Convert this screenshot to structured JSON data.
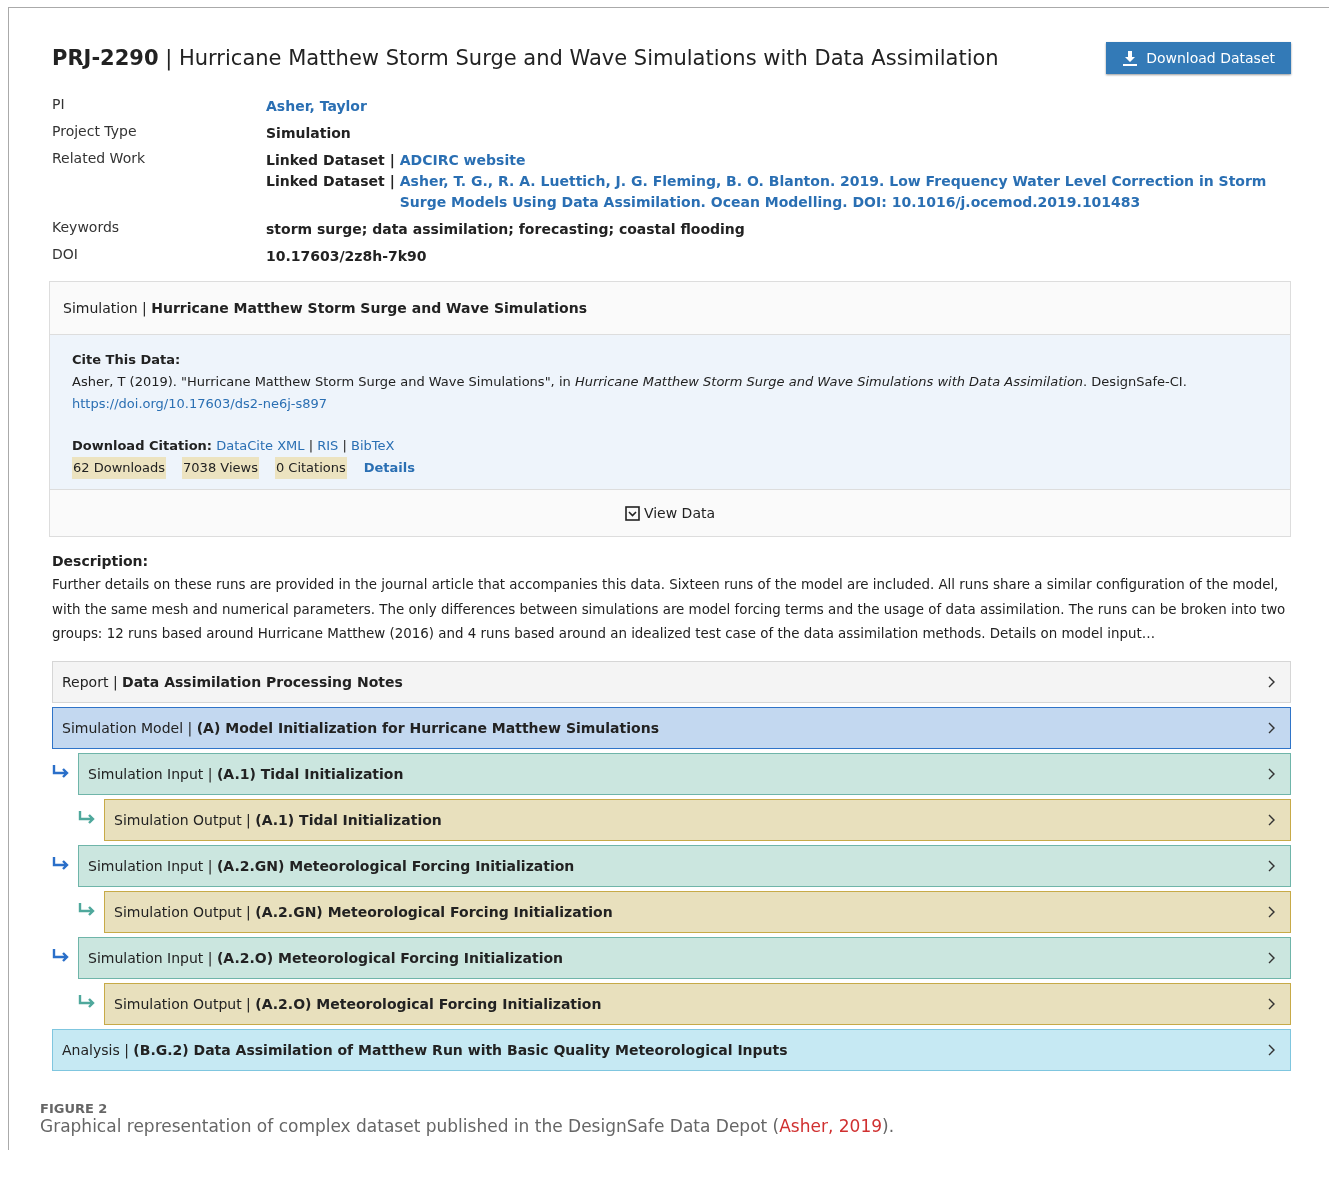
{
  "header": {
    "project_id": "PRJ-2290",
    "separator": "|",
    "title": "Hurricane Matthew Storm Surge and Wave Simulations with Data Assimilation",
    "download_button": "Download Dataset"
  },
  "metadata": [
    {
      "kind": "link",
      "label": "PI",
      "value": "Asher, Taylor"
    },
    {
      "kind": "text",
      "label": "Project Type",
      "value": "Simulation"
    },
    {
      "kind": "related",
      "label": "Related Work",
      "items": [
        {
          "type": "Linked Dataset",
          "separator": "|",
          "link": "ADCIRC website"
        },
        {
          "type": "Linked Dataset",
          "separator": "|",
          "link": "Asher, T. G., R. A. Luettich, J. G. Fleming, B. O. Blanton. 2019. Low Frequency Water Level Correction in Storm Surge Models Using Data Assimilation. Ocean Modelling. DOI: 10.1016/j.ocemod.2019.101483"
        }
      ]
    },
    {
      "kind": "text",
      "label": "Keywords",
      "value": "storm surge; data assimilation; forecasting; coastal flooding"
    },
    {
      "kind": "text",
      "label": "DOI",
      "value": "10.17603/2z8h-7k90"
    }
  ],
  "simulation_panel": {
    "type": "Simulation",
    "separator": "|",
    "title": "Hurricane Matthew Storm Surge and Wave Simulations",
    "cite_heading": "Cite This Data:",
    "citation": "Asher, T (2019). \"Hurricane Matthew Storm Surge and Wave Simulations\", in *Hurricane Matthew Storm Surge and Wave Simulations with Data Assimilation*. DesignSafe-CI.",
    "doi_link": "https://doi.org/10.17603/ds2-ne6j-s897",
    "download_citation_label": "Download Citation:",
    "citation_formats": [
      {
        "name": "DataCite XML"
      },
      {
        "separator": "|",
        "name": "RIS"
      },
      {
        "separator": "|",
        "name": "BibTeX"
      }
    ],
    "stats": [
      "62 Downloads",
      "7038 Views",
      "0 Citations"
    ],
    "details_link": "Details",
    "view_data_button": "View Data"
  },
  "description": {
    "heading": "Description:",
    "text": "Further details on these runs are provided in the journal article that accompanies this data. Sixteen runs of the model are included. All runs share a similar configuration of the model, with the same mesh and numerical parameters. The only differences between simulations are model forcing terms and the usage of data assimilation. The runs can be broken into two groups: 12 runs based around Hurricane Matthew (2016) and 4 runs based around an idealized test case of the data assimilation methods. Details on model input…"
  },
  "entries": [
    {
      "kind": "report",
      "type": "Report",
      "separator": "|",
      "title": "Data Assimilation Processing Notes"
    },
    {
      "kind": "model",
      "type": "Simulation Model",
      "separator": "|",
      "title": "(A) Model Initialization for Hurricane Matthew Simulations",
      "children": [
        {
          "kind": "input",
          "type": "Simulation Input",
          "separator": "|",
          "title": "(A.1) Tidal Initialization",
          "children": [
            {
              "kind": "output",
              "type": "Simulation Output",
              "separator": "|",
              "title": "(A.1) Tidal Initialization"
            }
          ]
        },
        {
          "kind": "input",
          "type": "Simulation Input",
          "separator": "|",
          "title": "(A.2.GN) Meteorological Forcing Initialization",
          "children": [
            {
              "kind": "output",
              "type": "Simulation Output",
              "separator": "|",
              "title": "(A.2.GN) Meteorological Forcing Initialization"
            }
          ]
        },
        {
          "kind": "input",
          "type": "Simulation Input",
          "separator": "|",
          "title": "(A.2.O) Meteorological Forcing Initialization",
          "children": [
            {
              "kind": "output",
              "type": "Simulation Output",
              "separator": "|",
              "title": "(A.2.O) Meteorological Forcing Initialization"
            }
          ]
        }
      ]
    },
    {
      "kind": "analysis",
      "type": "Analysis",
      "separator": "|",
      "title": "(B.G.2) Data Assimilation of Matthew Run with Basic Quality Meteorological Inputs"
    }
  ],
  "caption": {
    "label": "FIGURE 2",
    "text_before": "Graphical representation of complex dataset published in the DesignSafe Data Depot (",
    "link": "Asher, 2019",
    "text_after": ")."
  }
}
